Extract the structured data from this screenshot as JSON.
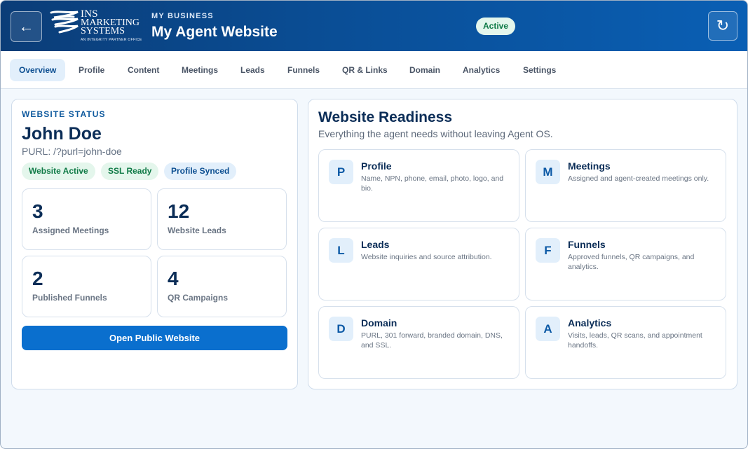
{
  "header": {
    "back_icon": "←",
    "refresh_icon": "↻",
    "logo": {
      "line1": "INS",
      "line2": "MARKETING",
      "line3": "SYSTEMS",
      "tagline": "AN INTEGRITY PARTNER OFFICE"
    },
    "eyebrow": "MY BUSINESS",
    "title": "My Agent Website",
    "status": "Active"
  },
  "tabs": [
    {
      "label": "Overview",
      "active": true
    },
    {
      "label": "Profile"
    },
    {
      "label": "Content"
    },
    {
      "label": "Meetings"
    },
    {
      "label": "Leads"
    },
    {
      "label": "Funnels"
    },
    {
      "label": "QR & Links"
    },
    {
      "label": "Domain"
    },
    {
      "label": "Analytics"
    },
    {
      "label": "Settings"
    }
  ],
  "status_card": {
    "label": "WEBSITE STATUS",
    "agent_name": "John Doe",
    "purl": "PURL: /?purl=john-doe",
    "badges": [
      "Website Active",
      "SSL Ready",
      "Profile Synced"
    ],
    "stats": [
      {
        "value": "3",
        "label": "Assigned Meetings"
      },
      {
        "value": "12",
        "label": "Website Leads"
      },
      {
        "value": "2",
        "label": "Published Funnels"
      },
      {
        "value": "4",
        "label": "QR Campaigns"
      }
    ],
    "open_button": "Open Public Website"
  },
  "readiness": {
    "title": "Website Readiness",
    "subtitle": "Everything the agent needs without leaving Agent OS.",
    "items": [
      {
        "icon": "P",
        "title": "Profile",
        "desc": "Name, NPN, phone, email, photo, logo, and bio."
      },
      {
        "icon": "M",
        "title": "Meetings",
        "desc": "Assigned and agent-created meetings only."
      },
      {
        "icon": "L",
        "title": "Leads",
        "desc": "Website inquiries and source attribution."
      },
      {
        "icon": "F",
        "title": "Funnels",
        "desc": "Approved funnels, QR campaigns, and analytics."
      },
      {
        "icon": "D",
        "title": "Domain",
        "desc": "PURL, 301 forward, branded domain, DNS, and SSL."
      },
      {
        "icon": "A",
        "title": "Analytics",
        "desc": "Visits, leads, QR scans, and appointment handoffs."
      }
    ]
  }
}
